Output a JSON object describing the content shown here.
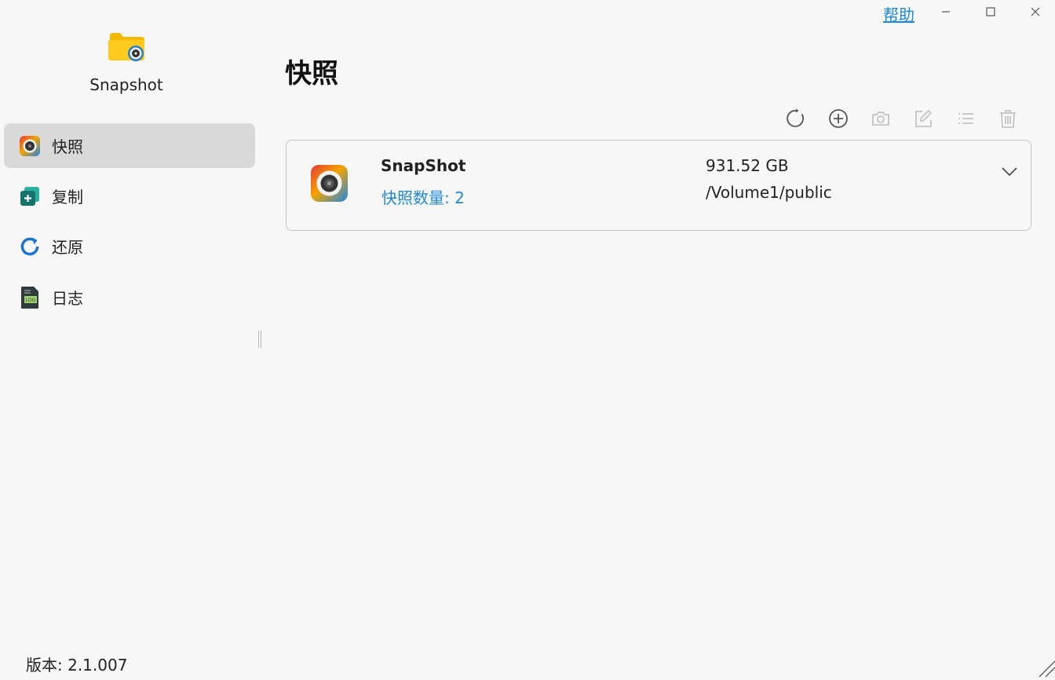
{
  "app": {
    "name": "Snapshot",
    "version": "版本: 2.1.007"
  },
  "titlebar": {
    "help": "帮助"
  },
  "sidebar": {
    "items": [
      {
        "label": "快照",
        "icon": "camera-icon",
        "active": true
      },
      {
        "label": "复制",
        "icon": "copy-icon"
      },
      {
        "label": "还原",
        "icon": "restore-icon"
      },
      {
        "label": "日志",
        "icon": "log-icon"
      }
    ]
  },
  "main": {
    "title": "快照",
    "toolbar": [
      "refresh-icon",
      "add-icon",
      "camera-icon",
      "edit-icon",
      "list-icon",
      "delete-icon"
    ],
    "snapshots": [
      {
        "name": "SnapShot",
        "count": "快照数量: 2",
        "size": "931.52 GB",
        "path": "/Volume1/public"
      }
    ]
  },
  "colors": {
    "accent": "#1e88d8",
    "active_nav": "#d9d9d9"
  }
}
